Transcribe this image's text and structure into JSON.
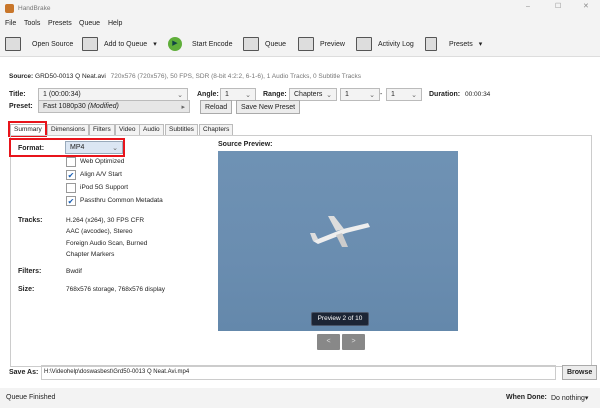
{
  "app_title": "HandBrake",
  "menu": [
    "File",
    "Tools",
    "Presets",
    "Queue",
    "Help"
  ],
  "toolbar": {
    "open_source": "Open Source",
    "add_to_queue": "Add to Queue",
    "start_encode": "Start Encode",
    "queue": "Queue",
    "preview": "Preview",
    "activity_log": "Activity Log",
    "presets": "Presets"
  },
  "source": {
    "label": "Source:",
    "name": "GRD50-0013 Q Neat.avi",
    "info": "720x576 (720x576), 50 FPS, SDR (8-bit 4:2:2, 6-1-6), 1 Audio Tracks, 0 Subtitle Tracks"
  },
  "title_row": {
    "title_label": "Title:",
    "title_value": "1 (00:00:34)",
    "angle_label": "Angle:",
    "angle_value": "1",
    "range_label": "Range:",
    "range_value": "Chapters",
    "range_start": "1",
    "range_sep": "-",
    "range_end": "1",
    "duration_label": "Duration:",
    "duration_value": "00:00:34"
  },
  "preset": {
    "label": "Preset:",
    "value": "Fast 1080p30",
    "modified": "(Modified)",
    "reload": "Reload",
    "save_new": "Save New Preset"
  },
  "tabs": [
    "Summary",
    "Dimensions",
    "Filters",
    "Video",
    "Audio",
    "Subtitles",
    "Chapters"
  ],
  "summary": {
    "format_label": "Format:",
    "format_value": "MP4",
    "options": [
      {
        "label": "Web Optimized",
        "checked": false
      },
      {
        "label": "Align A/V Start",
        "checked": true
      },
      {
        "label": "iPod 5G Support",
        "checked": false
      },
      {
        "label": "Passthru Common Metadata",
        "checked": true
      }
    ],
    "tracks_label": "Tracks:",
    "tracks": [
      "H.264 (x264), 30 FPS CFR",
      "AAC (avcodec), Stereo",
      "Foreign Audio Scan, Burned",
      "Chapter Markers"
    ],
    "filters_label": "Filters:",
    "filters_value": "Bwdif",
    "size_label": "Size:",
    "size_value": "768x576 storage, 768x576 display",
    "preview_label": "Source Preview:",
    "preview_badge": "Preview 2 of 10",
    "prev": "<",
    "next": ">"
  },
  "save_as": {
    "label": "Save As:",
    "value": "H:\\Videohelp\\doswasbest\\Grd50-0013 Q Neat.Avi.mp4",
    "browse": "Browse"
  },
  "status": {
    "text": "Queue Finished",
    "when_done_label": "When Done:",
    "when_done_value": "Do nothing"
  },
  "colors": {
    "highlight": "#e8141b",
    "sky": "#6a8db0"
  }
}
